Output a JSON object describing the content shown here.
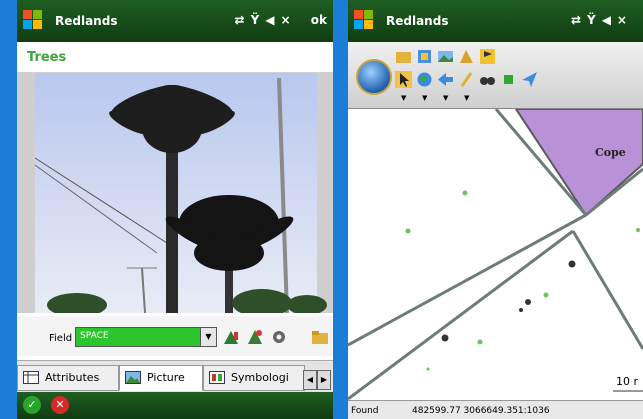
{
  "left_screen": {
    "title": "Redlands",
    "status_icons": [
      "sync-icon",
      "no-signal-icon",
      "speaker-mute-icon"
    ],
    "ok_label": "ok",
    "layer_name": "Trees",
    "field_label": "Field",
    "field_value": "SPACE",
    "tabs": [
      {
        "label": "Attributes"
      },
      {
        "label": "Picture"
      },
      {
        "label": "Symbologi"
      }
    ],
    "active_tab": "Picture"
  },
  "right_screen": {
    "title": "Redlands",
    "map_label": "Cope",
    "scale_text": "10 r",
    "status_label": "Found",
    "coordinates": "482599.77 3066649.351:1036"
  },
  "colors": {
    "titlebar": "#1a5a1e",
    "background": "#1a7ed8",
    "parcel_purple": "#b991d6",
    "field_green": "#2dc52d"
  }
}
